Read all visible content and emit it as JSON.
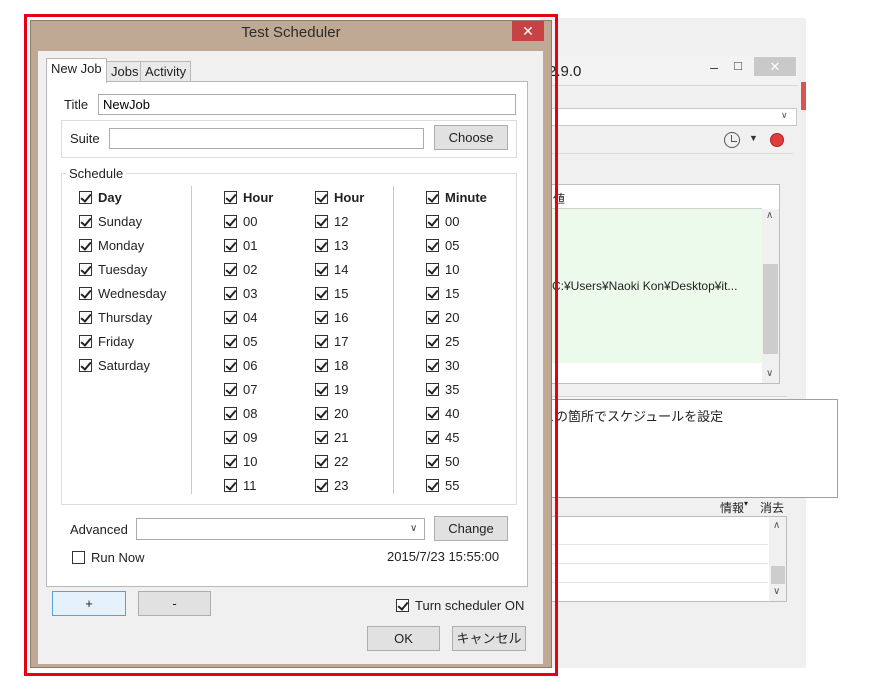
{
  "background_window": {
    "title": "2.9.0",
    "column_label": "値",
    "path_text": "C:¥Users¥Naoki Kon¥Desktop¥it...",
    "info_label": "情報",
    "clear_label": "消去"
  },
  "tooltip": {
    "text": "この箇所でスケジュールを設定"
  },
  "dialog": {
    "title": "Test Scheduler",
    "tabs": [
      "New Job",
      "Jobs",
      "Activity"
    ],
    "title_label": "Title",
    "title_value": "NewJob",
    "suite_label": "Suite",
    "suite_value": "",
    "choose_label": "Choose",
    "schedule_label": "Schedule",
    "columns": [
      {
        "header": "Day",
        "items": [
          "Sunday",
          "Monday",
          "Tuesday",
          "Wednesday",
          "Thursday",
          "Friday",
          "Saturday"
        ]
      },
      {
        "header": "Hour",
        "items": [
          "00",
          "01",
          "02",
          "03",
          "04",
          "05",
          "06",
          "07",
          "08",
          "09",
          "10",
          "11"
        ]
      },
      {
        "header": "Hour",
        "items": [
          "12",
          "13",
          "14",
          "15",
          "16",
          "17",
          "18",
          "19",
          "20",
          "21",
          "22",
          "23"
        ]
      },
      {
        "header": "Minute",
        "items": [
          "00",
          "05",
          "10",
          "15",
          "20",
          "25",
          "30",
          "35",
          "40",
          "45",
          "50",
          "55"
        ]
      }
    ],
    "advanced_label": "Advanced",
    "advanced_value": "",
    "change_label": "Change",
    "run_now_label": "Run Now",
    "run_now_checked": false,
    "datetime": "2015/7/23 15:55:00",
    "add_label": "+",
    "remove_label": "-",
    "scheduler_on_label": "Turn scheduler ON",
    "scheduler_on_checked": true,
    "ok_label": "OK",
    "cancel_label": "キャンセル"
  },
  "colors": {
    "highlight": "#e60012",
    "dialog_frame": "#bfa994",
    "close_button": "#c74343",
    "list_highlight": "#ebfaeb",
    "record_icon": "#e23b3b"
  }
}
